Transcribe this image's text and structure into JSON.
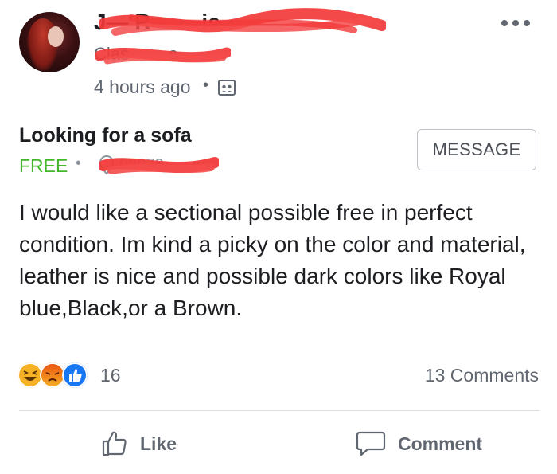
{
  "post": {
    "author_name": "J— R— —ic",
    "group_name": "Clas— —s",
    "timestamp": "4 hours ago",
    "separator": "•"
  },
  "listing": {
    "title": "Looking for a sofa",
    "price": "FREE",
    "separator": "•",
    "location": "02070",
    "message_button": "MESSAGE",
    "body": "I would like a sectional possible free in perfect condition.  Im kind a picky on the color and material, leather is nice and possible dark colors like Royal blue,Black,or a Brown."
  },
  "engagement": {
    "reaction_count": "16",
    "comments_label": "13 Comments",
    "reactions": [
      "haha-icon",
      "angry-icon",
      "like-icon"
    ]
  },
  "actions": {
    "like_label": "Like",
    "comment_label": "Comment"
  },
  "colors": {
    "price_green": "#42b72a",
    "redaction_red": "#f23a3a",
    "like_blue": "#1877f2"
  }
}
